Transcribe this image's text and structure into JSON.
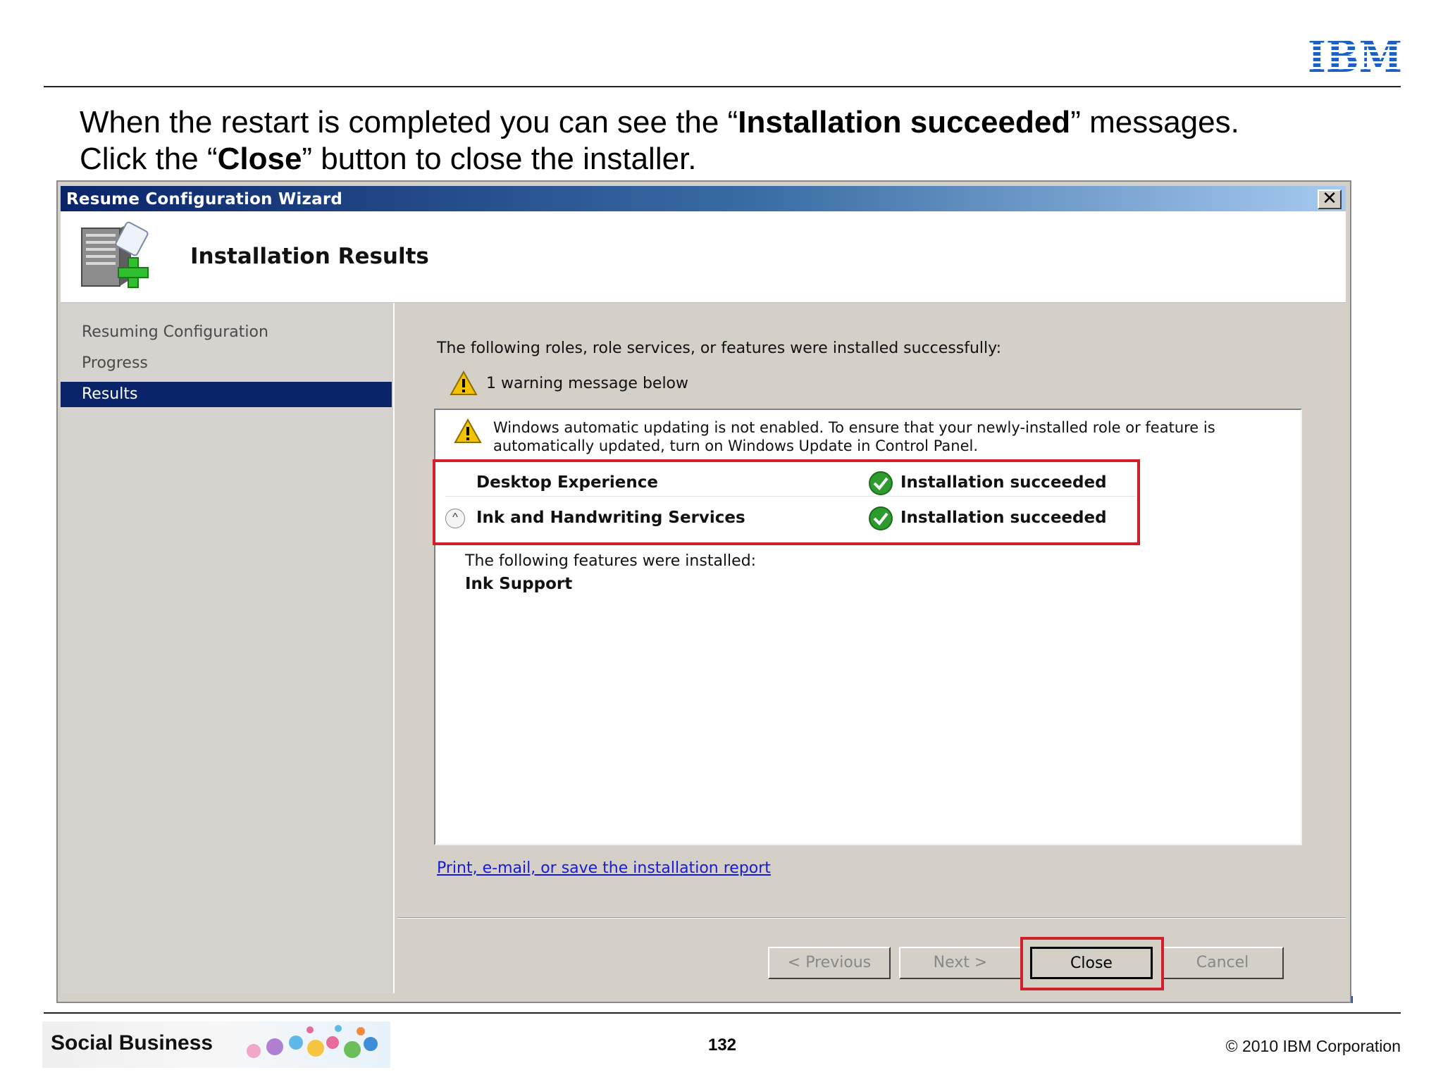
{
  "slide": {
    "logo": "IBM",
    "instruction_line1_pre": "When the restart is completed you can see the “",
    "instruction_line1_bold": "Installation succeeded",
    "instruction_line1_post": "” messages.",
    "instruction_line2_pre": "Click the “",
    "instruction_line2_bold": "Close",
    "instruction_line2_post": "” button to close the installer.",
    "footer_brand": "Social Business",
    "page_number": "132",
    "copyright": "© 2010 IBM Corporation"
  },
  "wizard": {
    "title": "Resume Configuration Wizard",
    "close_glyph": "✕",
    "header_title": "Installation Results",
    "header_icon": "server-add-icon",
    "nav": [
      {
        "label": "Resuming Configuration",
        "active": false
      },
      {
        "label": "Progress",
        "active": false
      },
      {
        "label": "Results",
        "active": true
      }
    ],
    "main": {
      "heading": "The following roles, role services, or features were installed successfully:",
      "warning_summary": "1 warning message below",
      "warning_text": "Windows automatic updating is not enabled. To ensure that your newly-installed role or feature is automatically updated, turn on Windows Update in Control Panel.",
      "roles": [
        {
          "name": "Desktop Experience",
          "status": "Installation succeeded"
        },
        {
          "name": "Ink and Handwriting Services",
          "status": "Installation succeeded"
        }
      ],
      "features_label": "The following features were installed:",
      "feature_name": "Ink Support",
      "report_link": "Print, e-mail, or save the installation report"
    },
    "buttons": {
      "previous": "< Previous",
      "next": "Next >",
      "close": "Close",
      "cancel": "Cancel"
    }
  },
  "colors": {
    "titlebar": "#0a246a",
    "highlight": "#d21f2b",
    "link": "#1a1ad6",
    "ibm_blue": "#1f5fbf",
    "success_green": "#2e9b2e",
    "warning_yellow": "#f2c200"
  }
}
